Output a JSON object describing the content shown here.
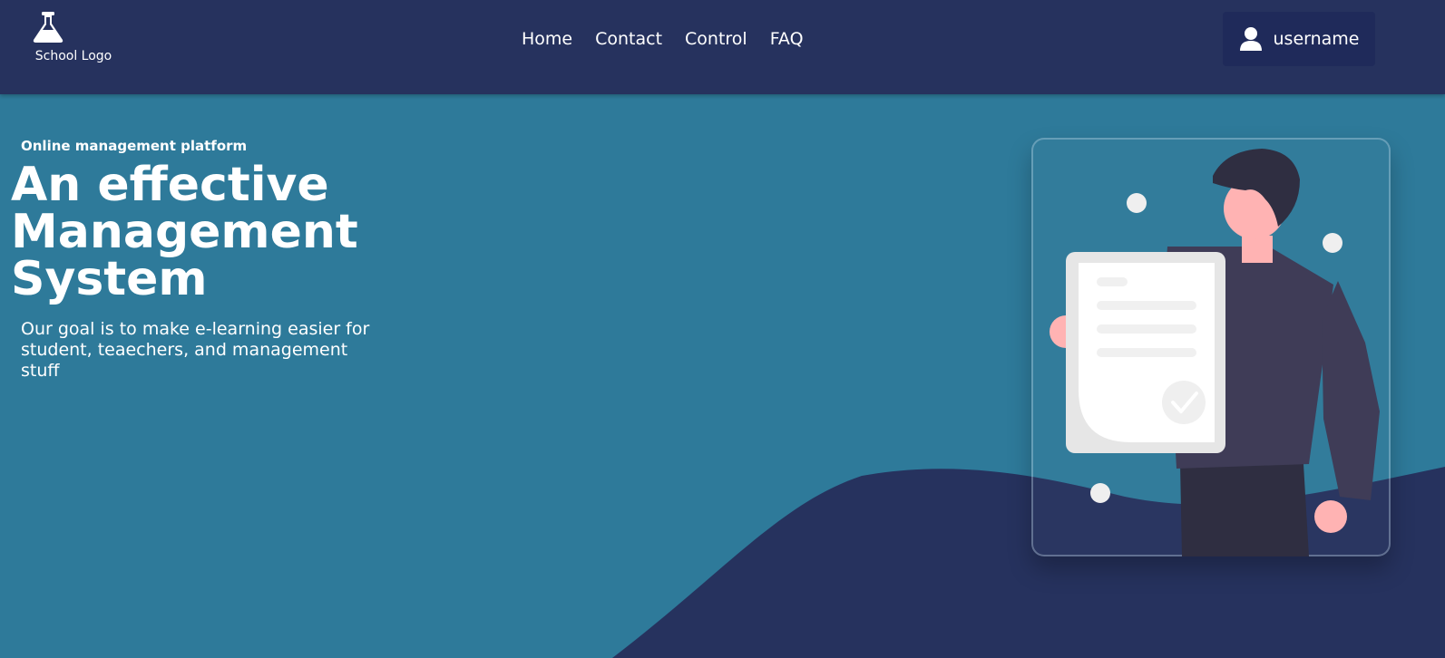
{
  "header": {
    "logo_label": "School Logo",
    "logo_icon": "flask-icon",
    "nav": [
      {
        "label": "Home"
      },
      {
        "label": "Contact"
      },
      {
        "label": "Control"
      },
      {
        "label": "FAQ"
      }
    ],
    "user": {
      "icon": "user-icon",
      "name": "username"
    }
  },
  "hero": {
    "eyebrow": "Online management platform",
    "title": "An effective Management System",
    "description": "Our goal is to make e-learning easier for student, teaechers, and management stuff"
  },
  "colors": {
    "navbar_bg": "#26325e",
    "hero_bg": "#2e7a9a",
    "wave": "#26325e",
    "user_button_bg": "#1f2a5a",
    "text": "#ffffff",
    "accent_skin": "#ffb3b3",
    "shirt": "#3f3c57"
  }
}
